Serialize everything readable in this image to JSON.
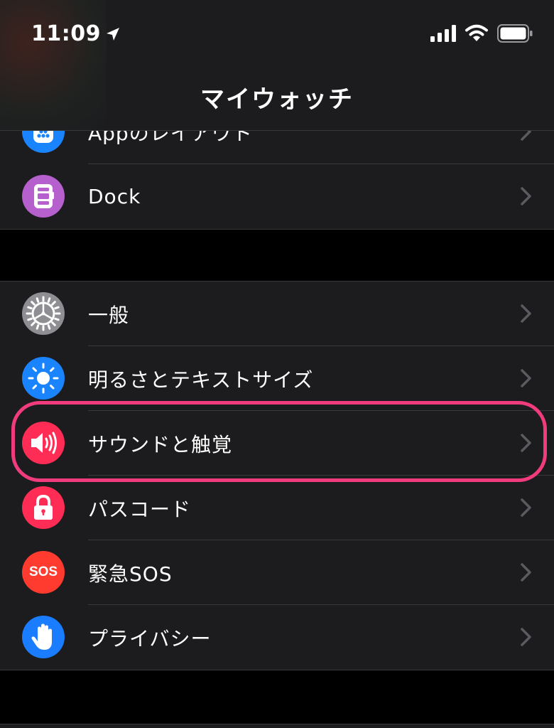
{
  "status_bar": {
    "time": "11:09"
  },
  "nav": {
    "title": "マイウォッチ"
  },
  "group1": [
    {
      "label": "Appのレイアウト",
      "icon": "app-layout-icon",
      "color": "#1a84ff"
    },
    {
      "label": "Dock",
      "icon": "dock-icon",
      "color": "#b660cd"
    }
  ],
  "group2": [
    {
      "label": "一般",
      "icon": "gear-icon",
      "color": "#8e8e93"
    },
    {
      "label": "明るさとテキストサイズ",
      "icon": "brightness-icon",
      "color": "#1a84ff"
    },
    {
      "label": "サウンドと触覚",
      "icon": "speaker-icon",
      "color": "#ff2d55"
    },
    {
      "label": "パスコード",
      "icon": "lock-icon",
      "color": "#ff2d55"
    },
    {
      "label": "緊急SOS",
      "icon": "sos-icon",
      "color": "#ff3b30",
      "icon_text": "SOS"
    },
    {
      "label": "プライバシー",
      "icon": "hand-icon",
      "color": "#1a7cff"
    }
  ],
  "highlight": {
    "target": "サウンドと触覚",
    "color": "#f03c7c"
  }
}
